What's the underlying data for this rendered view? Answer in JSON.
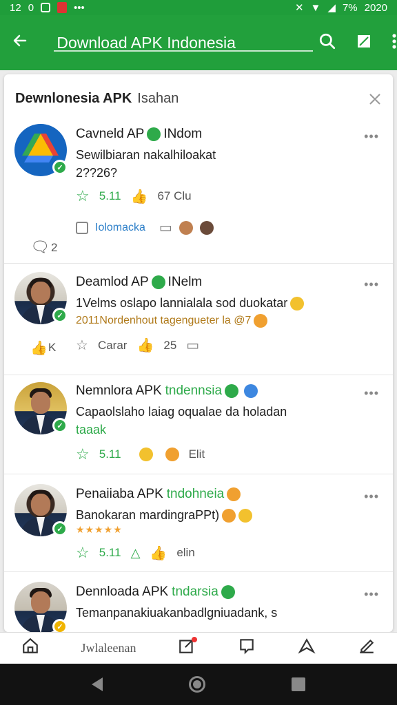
{
  "status_bar": {
    "time": "12",
    "left_glyphs": [
      "0"
    ],
    "right_text": "7%",
    "clock": "2020"
  },
  "app_bar": {
    "title": "Download APK Indonesia"
  },
  "panel": {
    "title": "Dewnlonesia APK",
    "subtitle": "Isahan"
  },
  "items": [
    {
      "name": "Cavneld AP",
      "name_suffix": "INdom",
      "desc_line1": "Sewilbiaran nakalhiloakat",
      "desc_line2": "2??26?",
      "rating": "5.11",
      "count": "67 Clu",
      "tag_label": "Iolomacka",
      "side_count": "2"
    },
    {
      "name": "Deamlod AP",
      "name_suffix": "INelm",
      "desc_line1": "1Velms oslapo lannialala sod duokatar",
      "desc_line2": "2011Nordenhout tagengueter la @7",
      "action1": "Carar",
      "count": "25",
      "side_count": "K"
    },
    {
      "name": "Nemnlora APK",
      "name_green": "tndennsia",
      "desc_line1": "Capaolslaho laiag oqualae da holadan",
      "desc_line2": "taaak",
      "rating": "5.11",
      "count": "Elit"
    },
    {
      "name": "Penaiiaba APK",
      "name_green": "tndohneia",
      "desc_line1": "Banokaran mardingraPPt)",
      "stars": "★★★★★",
      "rating": "5.11",
      "count": "elin"
    },
    {
      "name": "Dennloada APK",
      "name_green": "tndarsia",
      "desc_line1": "Temanpanakiuakanbadlgniuadank, s"
    }
  ],
  "bottom_nav": {
    "label": "Jwlaleenan"
  },
  "icons": {
    "back": "arrow-left-icon",
    "search": "search-icon",
    "save": "bookmark-icon",
    "more": "more-vert-icon",
    "close": "close-icon"
  },
  "colors": {
    "accent": "#22a03c",
    "status_bar": "#1f9d3a"
  }
}
